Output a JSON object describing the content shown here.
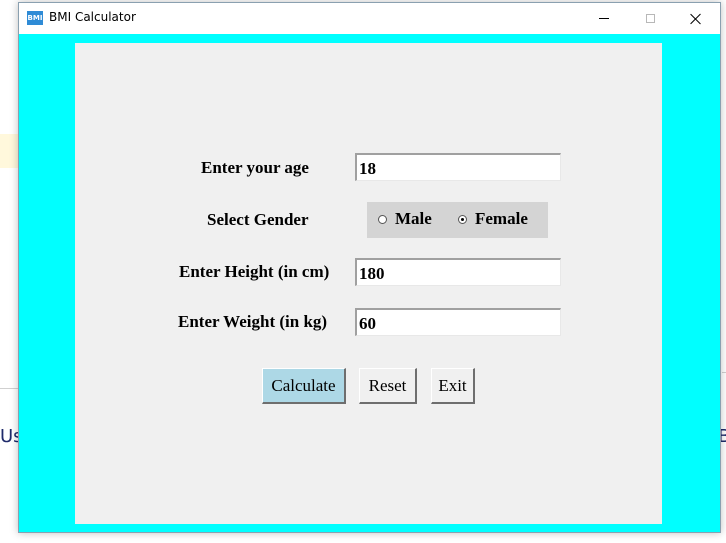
{
  "window": {
    "title": "BMI Calculator",
    "icon_name": "bmi-app-icon",
    "icon_text": "BMI"
  },
  "background": {
    "left_text": "Us",
    "right_text": "B"
  },
  "form": {
    "age": {
      "label": "Enter your age",
      "value": "18"
    },
    "gender": {
      "label": "Select Gender",
      "options": [
        {
          "label": "Male",
          "selected": false
        },
        {
          "label": "Female",
          "selected": true
        }
      ]
    },
    "height": {
      "label": "Enter Height (in cm)",
      "value": "180"
    },
    "weight": {
      "label": "Enter Weight (in kg)",
      "value": "60"
    }
  },
  "buttons": {
    "calculate": "Calculate",
    "reset": "Reset",
    "exit": "Exit"
  },
  "colors": {
    "window_bg": "#00ffff",
    "panel_bg": "#f0f0f0",
    "calculate_button_bg": "#add8e6",
    "radio_group_bg": "#d4d4d4"
  }
}
